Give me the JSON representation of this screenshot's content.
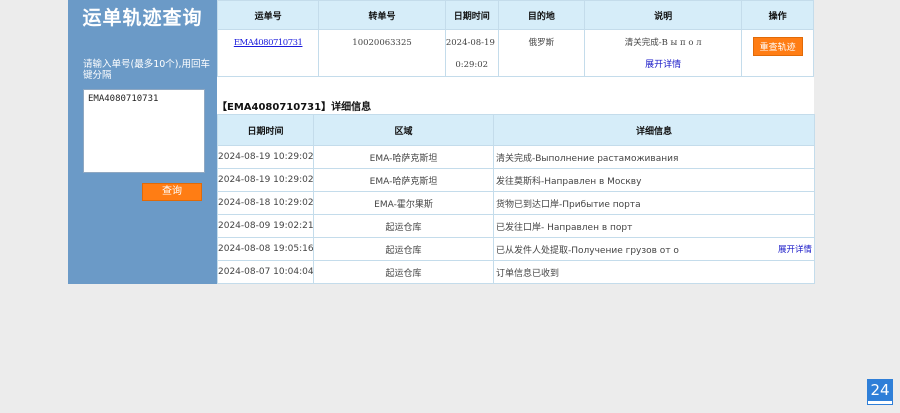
{
  "sidebar": {
    "title": "运单轨迹查询",
    "hint": "请输入单号(最多10个),用回车键分隔",
    "input_value": "EMA4080710731",
    "query_button": "查询"
  },
  "summary_table": {
    "headers": [
      "运单号",
      "转单号",
      "日期时间",
      "目的地",
      "说明",
      "操作"
    ],
    "row": {
      "waybill": "EMA4080710731",
      "transfer_no": "10020063325",
      "datetime_line1": "2024-08-19 1",
      "datetime_line2": "0:29:02",
      "destination": "俄罗斯",
      "description": "清关完成-В ы п о л",
      "expand_link": "展开详情",
      "retrack_button": "重查轨迹"
    }
  },
  "detail": {
    "heading": "【EMA4080710731】详细信息",
    "headers": [
      "日期时间",
      "区域",
      "详细信息"
    ],
    "rows": [
      {
        "datetime": "2024-08-19 10:29:02",
        "region": "EMA-哈萨克斯坦",
        "info": "清关完成-Выполнение растаможивания",
        "more": ""
      },
      {
        "datetime": "2024-08-19 10:29:02",
        "region": "EMA-哈萨克斯坦",
        "info": "发往莫斯科-Направлен в Москву",
        "more": ""
      },
      {
        "datetime": "2024-08-18 10:29:02",
        "region": "EMA-霍尔果斯",
        "info": "货物已到达口岸-Прибытие порта",
        "more": ""
      },
      {
        "datetime": "2024-08-09 19:02:21",
        "region": "起运仓库",
        "info": "已发往口岸- Направлен в порт",
        "more": ""
      },
      {
        "datetime": "2024-08-08 19:05:16",
        "region": "起运仓库",
        "info": "已从发件人处提取-Получение грузов от о",
        "more": "展开详情"
      },
      {
        "datetime": "2024-08-07 10:04:04",
        "region": "起运仓库",
        "info": "订单信息已收到",
        "more": ""
      }
    ]
  },
  "corner_badge": "24",
  "colors": {
    "sidebar_bg": "#6b9ac7",
    "header_bg": "#d6edf9",
    "accent_orange": "#ff7d14",
    "link_blue": "#1a1ac8"
  }
}
